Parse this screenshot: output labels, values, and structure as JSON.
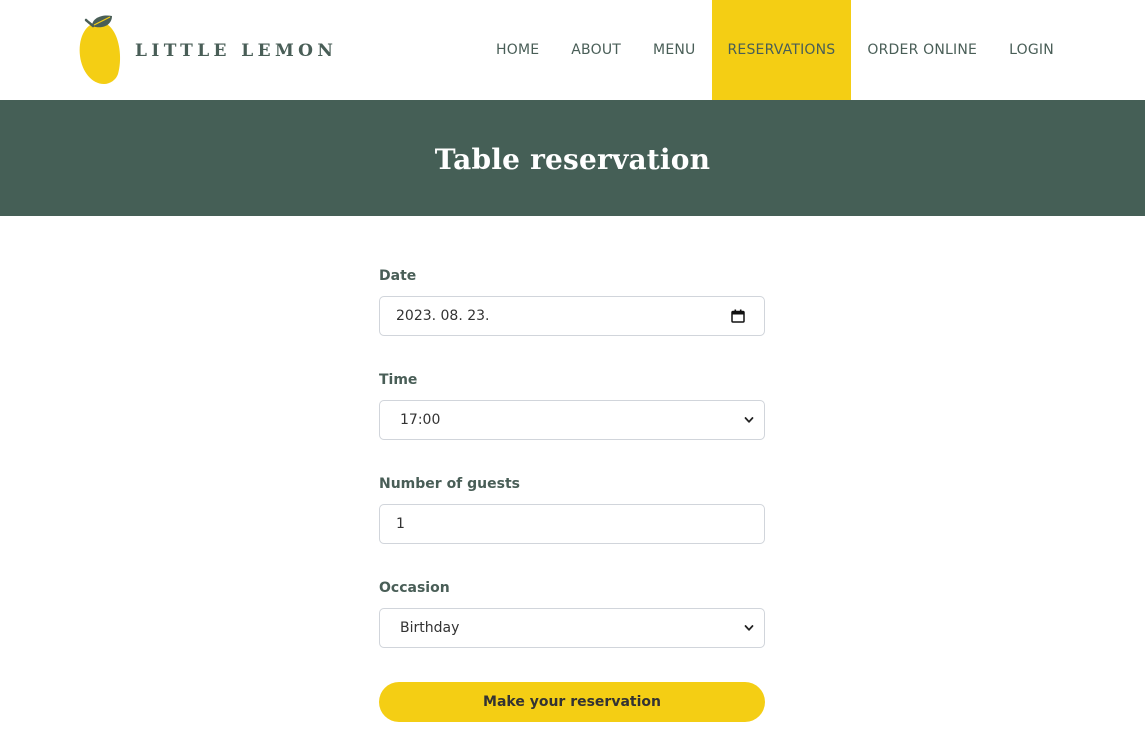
{
  "brand": {
    "name": "LITTLE LEMON",
    "accent_color": "#F4CE14",
    "primary_color": "#495E57"
  },
  "nav": {
    "items": [
      {
        "label": "HOME",
        "active": false
      },
      {
        "label": "ABOUT",
        "active": false
      },
      {
        "label": "MENU",
        "active": false
      },
      {
        "label": "RESERVATIONS",
        "active": true
      },
      {
        "label": "ORDER ONLINE",
        "active": false
      },
      {
        "label": "LOGIN",
        "active": false
      }
    ]
  },
  "hero": {
    "title": "Table reservation"
  },
  "form": {
    "date": {
      "label": "Date",
      "value": "2023. 08. 23.",
      "icon": "calendar-icon"
    },
    "time": {
      "label": "Time",
      "value": "17:00",
      "icon": "chevron-down-icon"
    },
    "guests": {
      "label": "Number of guests",
      "value": "1"
    },
    "occasion": {
      "label": "Occasion",
      "value": "Birthday",
      "icon": "chevron-down-icon"
    },
    "submit_label": "Make your reservation"
  }
}
